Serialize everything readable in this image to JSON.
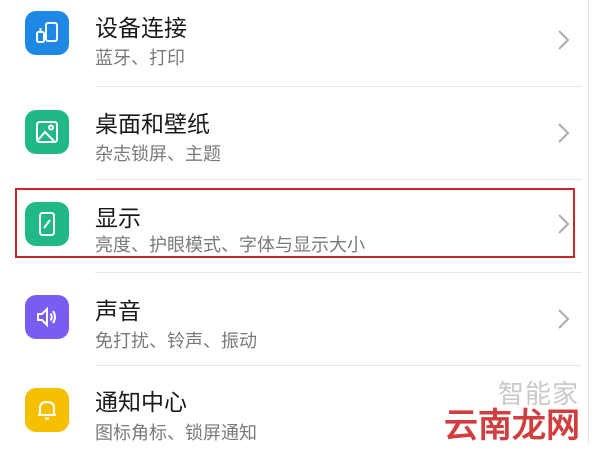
{
  "colors": {
    "devices": "#1e88e5",
    "wallpaper": "#1fb886",
    "display": "#1fb886",
    "sound": "#7b5cf0",
    "notification": "#f5c000",
    "highlight": "#c62828"
  },
  "settings_items": [
    {
      "title": "设备连接",
      "subtitle": "蓝牙、打印",
      "icon": "device-link-icon"
    },
    {
      "title": "桌面和壁纸",
      "subtitle": "杂志锁屏、主题",
      "icon": "image-icon"
    },
    {
      "title": "显示",
      "subtitle": "亮度、护眼模式、字体与显示大小",
      "icon": "phone-brightness-icon",
      "highlighted": true
    },
    {
      "title": "声音",
      "subtitle": "免打扰、铃声、振动",
      "icon": "speaker-icon"
    },
    {
      "title": "通知中心",
      "subtitle": "图标角标、锁屏通知",
      "icon": "bell-icon"
    }
  ],
  "watermark": {
    "top": "智能家",
    "bottom": "云南龙网"
  }
}
